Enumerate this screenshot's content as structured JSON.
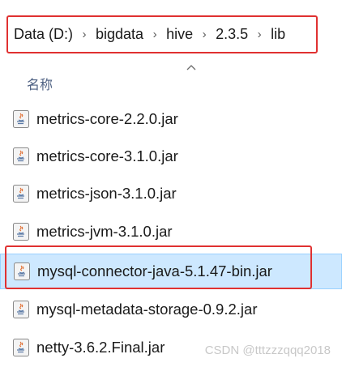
{
  "breadcrumb": {
    "items": [
      "Data (D:)",
      "bigdata",
      "hive",
      "2.3.5",
      "lib"
    ],
    "separator": "›"
  },
  "list_header": {
    "name_column": "名称",
    "sort_icon": "chevron-up-icon"
  },
  "files": [
    {
      "name": "metrics-core-2.2.0.jar",
      "icon": "java-jar-icon",
      "selected": false
    },
    {
      "name": "metrics-core-3.1.0.jar",
      "icon": "java-jar-icon",
      "selected": false
    },
    {
      "name": "metrics-json-3.1.0.jar",
      "icon": "java-jar-icon",
      "selected": false
    },
    {
      "name": "metrics-jvm-3.1.0.jar",
      "icon": "java-jar-icon",
      "selected": false
    },
    {
      "name": "mysql-connector-java-5.1.47-bin.jar",
      "icon": "java-jar-icon",
      "selected": true
    },
    {
      "name": "mysql-metadata-storage-0.9.2.jar",
      "icon": "java-jar-icon",
      "selected": false
    },
    {
      "name": "netty-3.6.2.Final.jar",
      "icon": "java-jar-icon",
      "selected": false
    }
  ],
  "watermark": "CSDN @tttzzzqqq2018",
  "colors": {
    "highlight_outline": "#e03131",
    "selection_bg": "#cde8ff",
    "selection_border": "#99d1ff",
    "header_text": "#4d6082"
  }
}
